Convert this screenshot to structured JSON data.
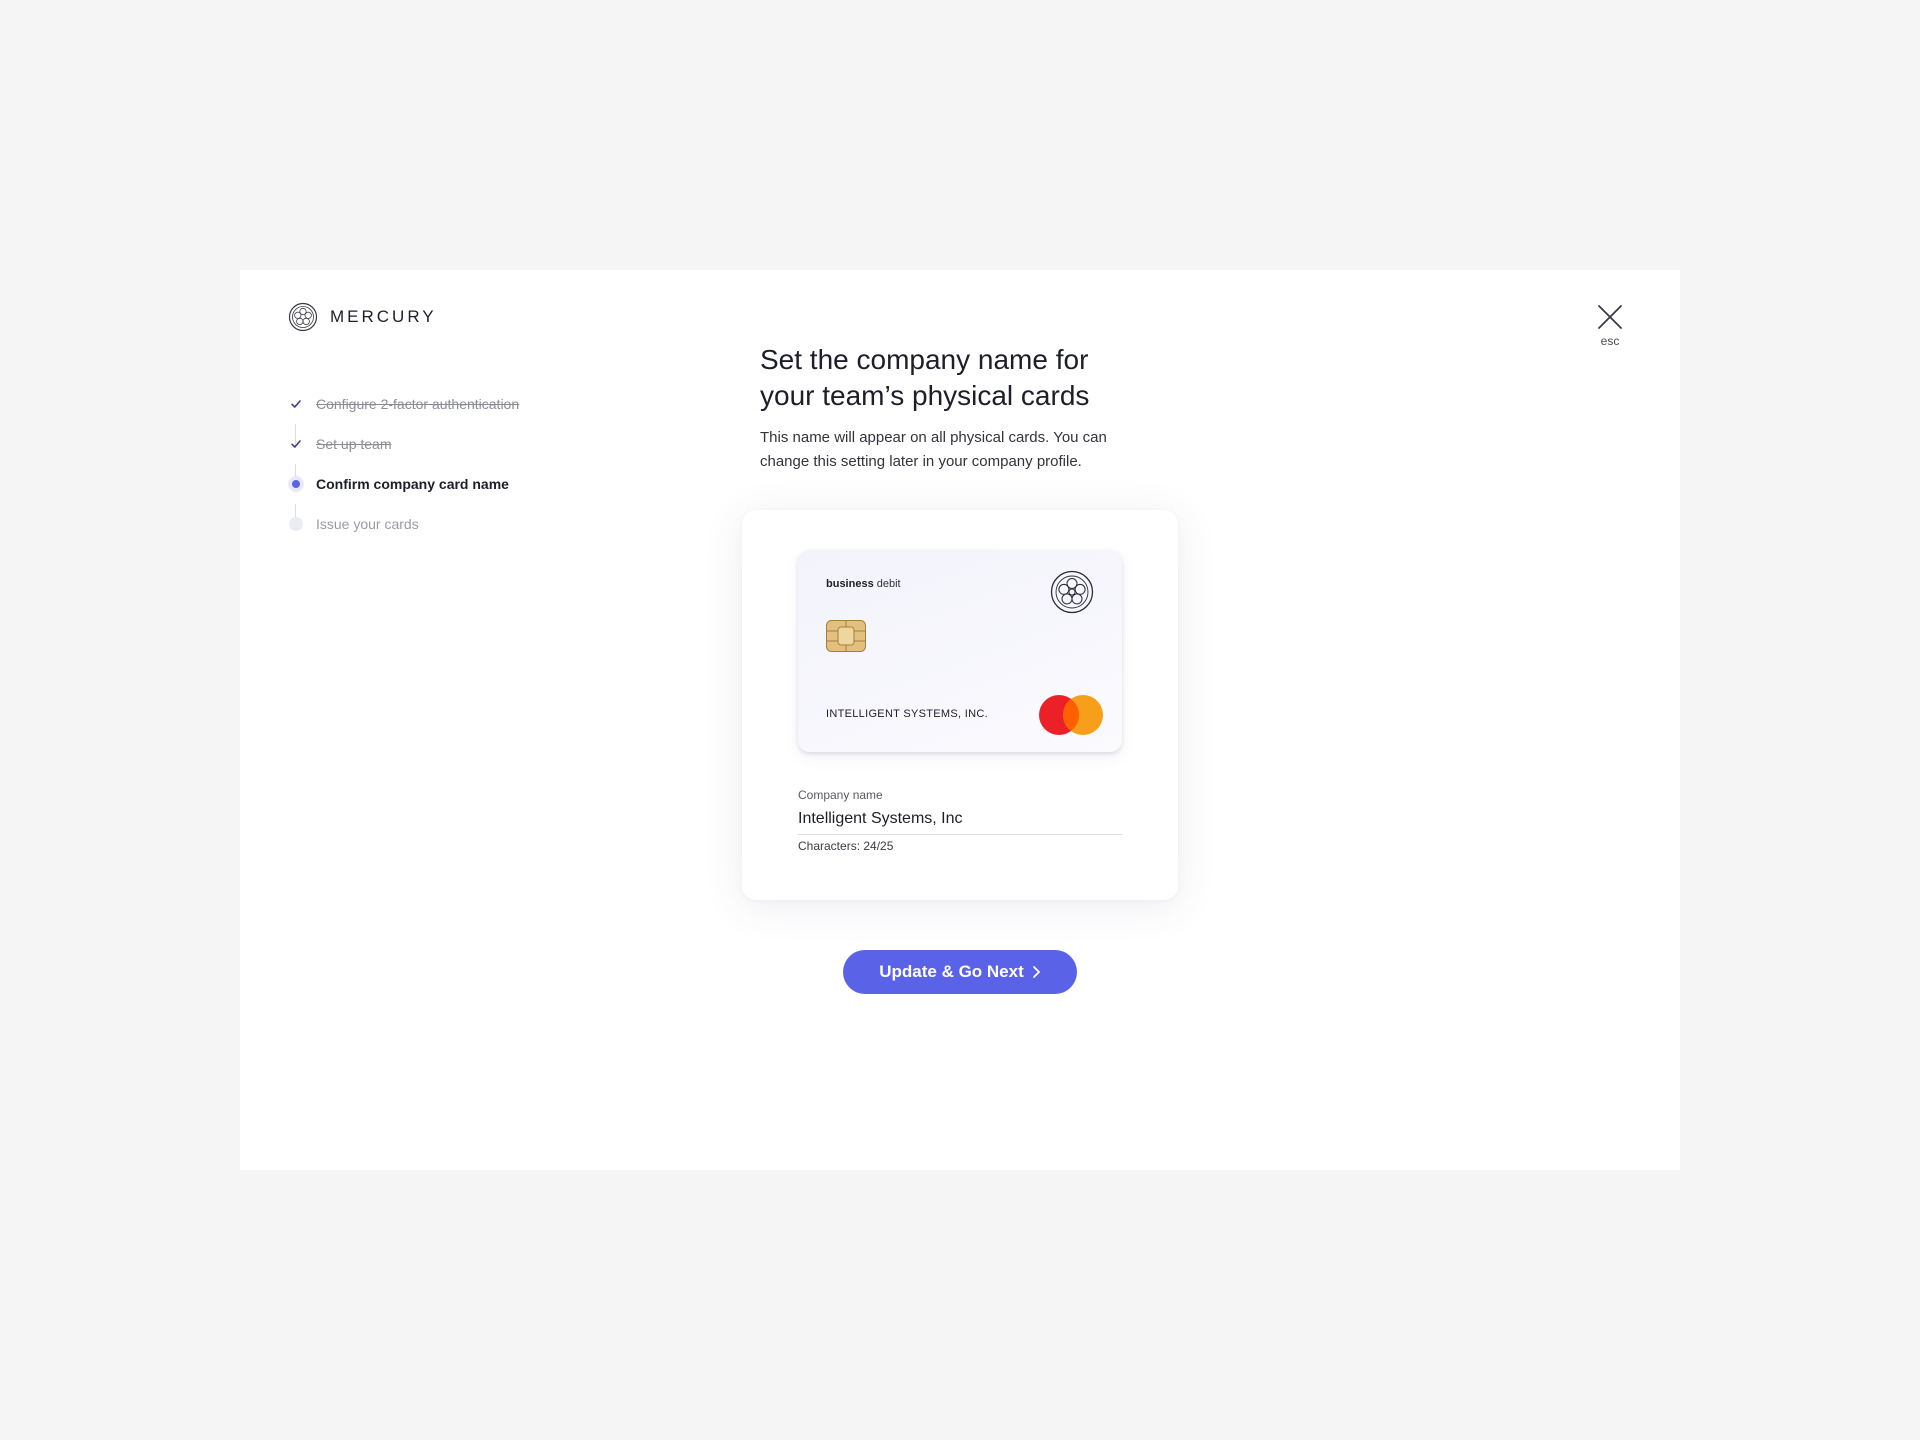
{
  "brand": {
    "name": "MERCURY",
    "logo_icon": "mercury-logo-icon"
  },
  "close": {
    "label": "esc",
    "icon": "close-icon"
  },
  "steps": [
    {
      "label": "Configure 2-factor authentication",
      "status": "done",
      "icon": "check-icon"
    },
    {
      "label": "Set up team",
      "status": "done",
      "icon": "check-icon"
    },
    {
      "label": "Confirm company card name",
      "status": "active",
      "icon": "active-step-dot-icon"
    },
    {
      "label": "Issue your cards",
      "status": "pending",
      "icon": "pending-step-dot-icon"
    }
  ],
  "main": {
    "title_line1": "Set the company name for",
    "title_line2": "your team’s physical cards",
    "description_line1": "This name will appear on all physical cards. You can",
    "description_line2": "change this setting later in your company profile."
  },
  "card_preview": {
    "type_bold": "business",
    "type_rest": "debit",
    "holder_name": "INTELLIGENT SYSTEMS, INC.",
    "emblem_icon": "mercury-emblem-icon",
    "chip_icon": "card-chip-icon",
    "network_icon": "mastercard-logo-icon"
  },
  "company_field": {
    "label": "Company name",
    "value": "Intelligent Systems, Inc",
    "char_count": "Characters: 24/25"
  },
  "cta": {
    "label": "Update & Go Next",
    "icon": "chevron-right-icon"
  },
  "colors": {
    "accent": "#5a63e8",
    "page_background": "#f5f5f5",
    "mastercard_red": "#eb2127",
    "mastercard_orange": "#f79e1b",
    "chip_gold": "#e3c07f"
  }
}
